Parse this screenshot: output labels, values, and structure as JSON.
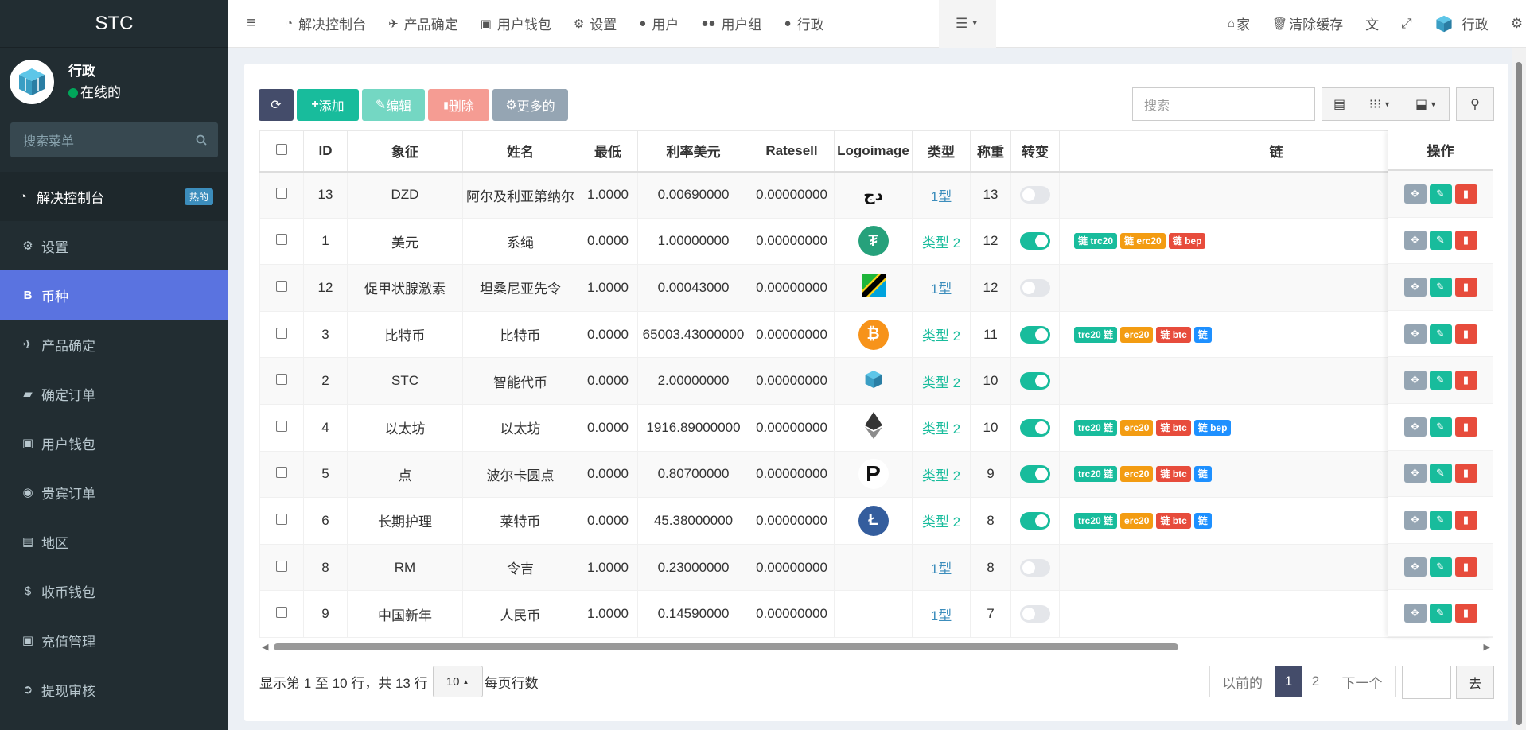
{
  "brand": "STC",
  "user": {
    "name": "行政",
    "status": "在线的"
  },
  "sidebar": {
    "search_placeholder": "搜索菜单",
    "items": [
      {
        "label": "解决控制台",
        "icon": "dashboard-icon",
        "badge": "热的"
      },
      {
        "label": "设置",
        "icon": "gear-icon"
      },
      {
        "label": "币种",
        "icon": "bitcoin-icon"
      },
      {
        "label": "产品确定",
        "icon": "plane-icon"
      },
      {
        "label": "确定订单",
        "icon": "book-icon"
      },
      {
        "label": "用户钱包",
        "icon": "money-icon"
      },
      {
        "label": "贵宾订单",
        "icon": "chevron-circle-icon"
      },
      {
        "label": "地区",
        "icon": "phone-square-icon"
      },
      {
        "label": "收币钱包",
        "icon": "dollar-icon"
      },
      {
        "label": "充值管理",
        "icon": "money-icon"
      },
      {
        "label": "提现审核",
        "icon": "arrow-circle-icon"
      }
    ]
  },
  "topbar": {
    "tabs": [
      {
        "label": "解决控制台",
        "icon": "dashboard-icon"
      },
      {
        "label": "产品确定",
        "icon": "plane-icon"
      },
      {
        "label": "用户钱包",
        "icon": "money-icon"
      },
      {
        "label": "设置",
        "icon": "gear-icon"
      },
      {
        "label": "用户",
        "icon": "user-icon"
      },
      {
        "label": "用户组",
        "icon": "users-icon"
      },
      {
        "label": "行政",
        "icon": "user-icon"
      }
    ],
    "home": "家",
    "clear_cache": "清除缓存",
    "admin": "行政"
  },
  "toolbar": {
    "add": "添加",
    "edit": "编辑",
    "delete": "删除",
    "more": "更多的",
    "search_placeholder": "搜索"
  },
  "table": {
    "headers": [
      "ID",
      "象征",
      "姓名",
      "最低",
      "利率美元",
      "Ratesell",
      "Logoimage",
      "类型",
      "称重",
      "转变",
      "链",
      "操作"
    ],
    "rows": [
      {
        "id": "13",
        "symbol": "DZD",
        "name": "阿尔及利亚第纳尔",
        "min": "1.0000",
        "rate": "0.00690000",
        "ratesell": "0.00000000",
        "logo": "dzd",
        "type": "1型",
        "type_style": "plain",
        "weight": "13",
        "on": false,
        "chains": []
      },
      {
        "id": "1",
        "symbol": "美元",
        "name": "系绳",
        "min": "0.0000",
        "rate": "1.00000000",
        "ratesell": "0.00000000",
        "logo": "usdt",
        "type": "类型 2",
        "type_style": "link",
        "weight": "12",
        "on": true,
        "chains": [
          "链 trc20",
          "链 erc20",
          "链 bep"
        ]
      },
      {
        "id": "12",
        "symbol": "促甲状腺激素",
        "name": "坦桑尼亚先令",
        "min": "1.0000",
        "rate": "0.00043000",
        "ratesell": "0.00000000",
        "logo": "tz",
        "type": "1型",
        "type_style": "plain",
        "weight": "12",
        "on": false,
        "chains": []
      },
      {
        "id": "3",
        "symbol": "比特币",
        "name": "比特币",
        "min": "0.0000",
        "rate": "65003.43000000",
        "ratesell": "0.00000000",
        "logo": "btc",
        "type": "类型 2",
        "type_style": "link",
        "weight": "11",
        "on": true,
        "chains": [
          "trc20 链",
          "erc20",
          "链 btc",
          "链"
        ]
      },
      {
        "id": "2",
        "symbol": "STC",
        "name": "智能代币",
        "min": "0.0000",
        "rate": "2.00000000",
        "ratesell": "0.00000000",
        "logo": "stc",
        "type": "类型 2",
        "type_style": "link",
        "weight": "10",
        "on": true,
        "chains": []
      },
      {
        "id": "4",
        "symbol": "以太坊",
        "name": "以太坊",
        "min": "0.0000",
        "rate": "1916.89000000",
        "ratesell": "0.00000000",
        "logo": "eth",
        "type": "类型 2",
        "type_style": "link",
        "weight": "10",
        "on": true,
        "chains": [
          "trc20 链",
          "erc20",
          "链 btc",
          "链 bep"
        ]
      },
      {
        "id": "5",
        "symbol": "点",
        "name": "波尔卡圆点",
        "min": "0.0000",
        "rate": "0.80700000",
        "ratesell": "0.00000000",
        "logo": "dot",
        "type": "类型 2",
        "type_style": "link",
        "weight": "9",
        "on": true,
        "chains": [
          "trc20 链",
          "erc20",
          "链 btc",
          "链"
        ]
      },
      {
        "id": "6",
        "symbol": "长期护理",
        "name": "莱特币",
        "min": "0.0000",
        "rate": "45.38000000",
        "ratesell": "0.00000000",
        "logo": "ltc",
        "type": "类型 2",
        "type_style": "link",
        "weight": "8",
        "on": true,
        "chains": [
          "trc20 链",
          "erc20",
          "链 btc",
          "链"
        ]
      },
      {
        "id": "8",
        "symbol": "RM",
        "name": "令吉",
        "min": "1.0000",
        "rate": "0.23000000",
        "ratesell": "0.00000000",
        "logo": "",
        "type": "1型",
        "type_style": "plain",
        "weight": "8",
        "on": false,
        "chains": []
      },
      {
        "id": "9",
        "symbol": "中国新年",
        "name": "人民币",
        "min": "1.0000",
        "rate": "0.14590000",
        "ratesell": "0.00000000",
        "logo": "",
        "type": "1型",
        "type_style": "plain",
        "weight": "7",
        "on": false,
        "chains": []
      }
    ]
  },
  "footer": {
    "summary": "显示第 1 至 10 行，共 13 行",
    "page_size": "10",
    "per_page": "每页行数",
    "prev": "以前的",
    "pages": [
      "1",
      "2"
    ],
    "next": "下一个",
    "go": "去"
  },
  "colors": {
    "sidebar": "#222d32",
    "active": "#5a73e0",
    "success": "#18bc9c",
    "warning": "#f39c12",
    "danger": "#e74c3c",
    "primary": "#444c6a"
  }
}
